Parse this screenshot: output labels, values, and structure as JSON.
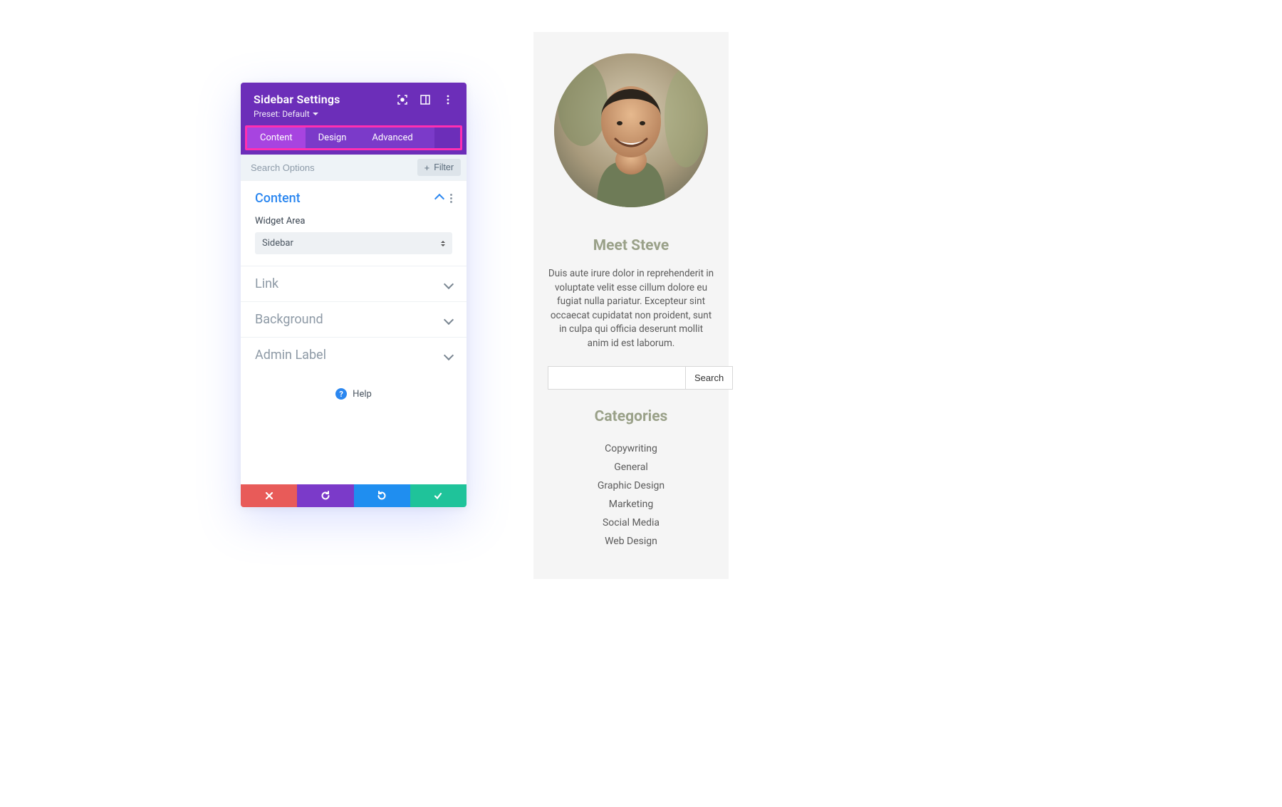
{
  "panel": {
    "title": "Sidebar Settings",
    "preset_label": "Preset: Default",
    "tabs": [
      "Content",
      "Design",
      "Advanced"
    ],
    "active_tab": 0,
    "search_placeholder": "Search Options",
    "filter_label": "Filter",
    "sections": {
      "content": {
        "title": "Content",
        "widget_area_label": "Widget Area",
        "widget_area_value": "Sidebar"
      },
      "link": {
        "title": "Link"
      },
      "background": {
        "title": "Background"
      },
      "admin_label": {
        "title": "Admin Label"
      }
    },
    "help_label": "Help"
  },
  "preview": {
    "meet_title": "Meet Steve",
    "bio": "Duis aute irure dolor in reprehenderit in voluptate velit esse cillum dolore eu fugiat nulla pariatur. Excepteur sint occaecat cupidatat non proident, sunt in culpa qui officia deserunt mollit anim id est laborum.",
    "search_button": "Search",
    "categories_title": "Categories",
    "categories": [
      "Copywriting",
      "General",
      "Graphic Design",
      "Marketing",
      "Social Media",
      "Web Design"
    ]
  }
}
